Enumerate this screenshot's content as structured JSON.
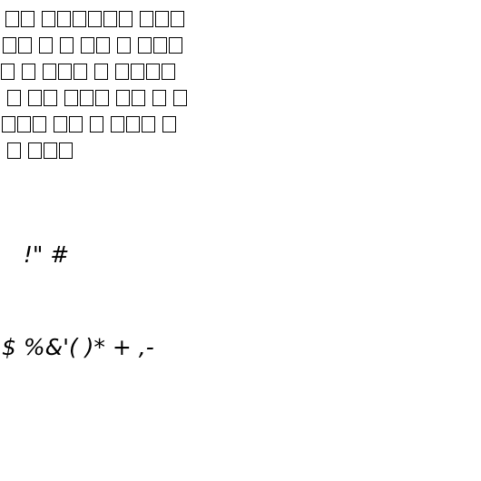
{
  "tofu_rows": [
    [
      2,
      6,
      3
    ],
    [
      2,
      1,
      1,
      2,
      1,
      3
    ],
    [
      1,
      1,
      3,
      1,
      4
    ],
    [
      1,
      2,
      3,
      2,
      1,
      1
    ],
    [
      3,
      2,
      1,
      3,
      1
    ],
    [
      1,
      3
    ]
  ],
  "symbol_lines": [
    "   !\" #",
    "$ %&'( )* + ,-"
  ]
}
